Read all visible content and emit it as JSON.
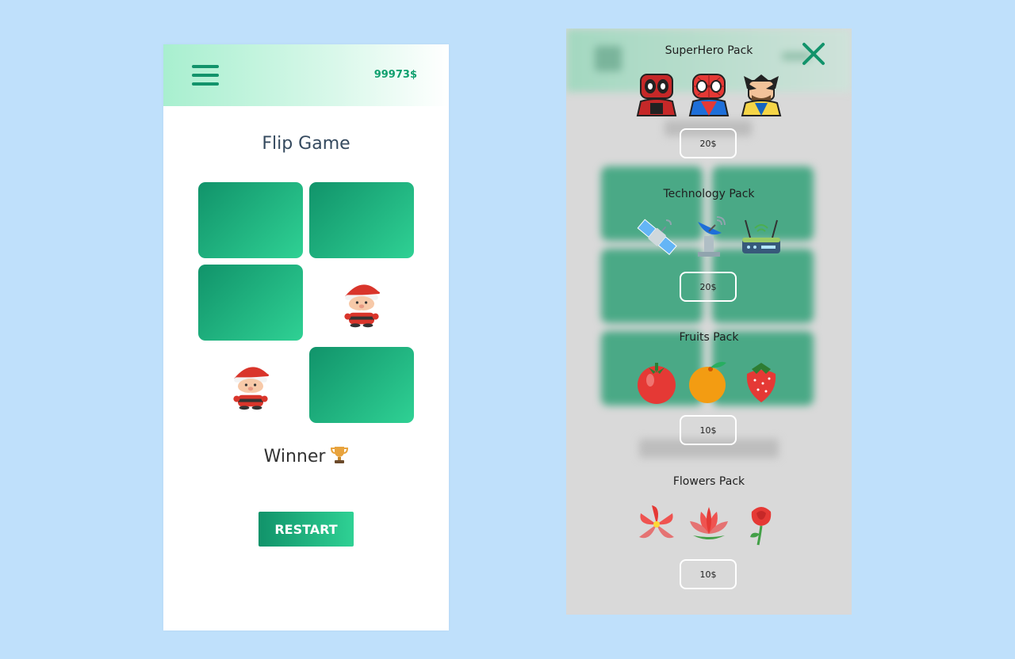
{
  "left_phone": {
    "coins": "99973$",
    "title": "Flip Game",
    "winner_text": "Winner",
    "restart_label": "RESTART"
  },
  "shop": {
    "packs": [
      {
        "title": "SuperHero Pack",
        "price": "20$",
        "icons": [
          "deadpool-icon",
          "spiderman-icon",
          "wolverine-icon"
        ]
      },
      {
        "title": "Technology Pack",
        "price": "20$",
        "icons": [
          "satellite-icon",
          "satellite-dish-icon",
          "router-icon"
        ]
      },
      {
        "title": "Fruits Pack",
        "price": "10$",
        "icons": [
          "tomato-icon",
          "orange-icon",
          "strawberry-icon"
        ]
      },
      {
        "title": "Flowers Pack",
        "price": "10$",
        "icons": [
          "lily-icon",
          "lotus-icon",
          "rose-icon"
        ]
      }
    ]
  },
  "colors": {
    "page_background": "#bfe0fb",
    "accent": "#12936b",
    "accent_light": "#2fd194",
    "overlay": "#d9d9d9"
  }
}
